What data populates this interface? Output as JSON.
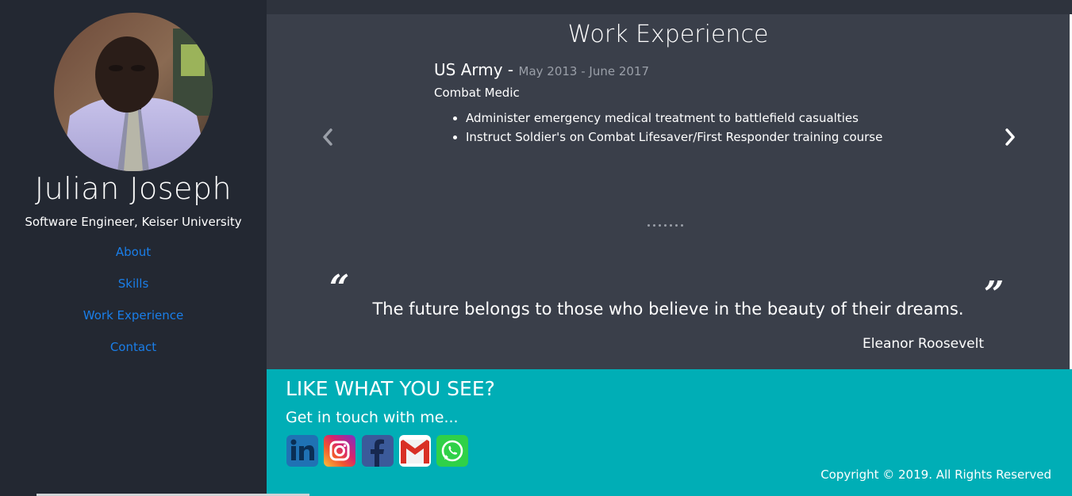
{
  "profile": {
    "name": "Julian Joseph",
    "subtitle": "Software Engineer, Keiser University"
  },
  "nav": {
    "items": [
      {
        "label": "About"
      },
      {
        "label": "Skills"
      },
      {
        "label": "Work Experience"
      },
      {
        "label": "Contact"
      }
    ]
  },
  "work": {
    "title": "Work Experience",
    "organization": "US Army",
    "separator": " - ",
    "dates": "May 2013 - June 2017",
    "role": "Combat Medic",
    "duties": [
      "Administer emergency medical treatment to battlefield casualties",
      "Instruct Soldier's on Combat Lifesaver/First Responder training course"
    ],
    "carousel_dot_count": 7
  },
  "quote": {
    "text": "The future belongs to those who believe in the beauty of their dreams.",
    "author": "Eleanor Roosevelt",
    "open_mark": "“",
    "close_mark": "”"
  },
  "contact": {
    "heading": "LIKE WHAT YOU SEE?",
    "subheading": "Get in touch with me...",
    "social": [
      "linkedin-icon",
      "instagram-icon",
      "facebook-icon",
      "gmail-icon",
      "whatsapp-icon"
    ],
    "copyright": "Copyright © 2019. All Rights Reserved"
  },
  "colors": {
    "sidebar_bg": "#232832",
    "main_bg": "#3a3f4a",
    "footer_bg": "#00aeb6",
    "link": "#1a7ee8",
    "muted": "#9a9fa8"
  }
}
